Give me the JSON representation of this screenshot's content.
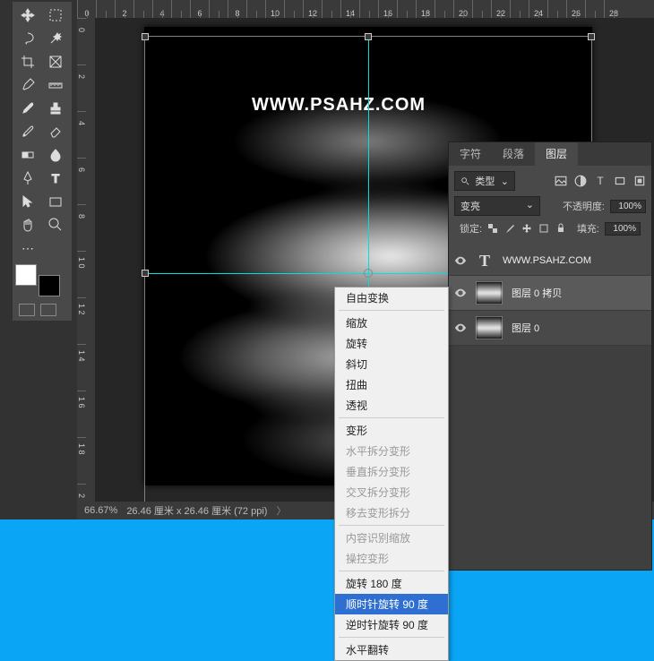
{
  "ruler_top": [
    "0",
    "",
    "2",
    "",
    "4",
    "",
    "6",
    "",
    "8",
    "",
    "10",
    "",
    "12",
    "",
    "14",
    "",
    "16",
    "",
    "18",
    "",
    "20",
    "",
    "22",
    "",
    "24",
    "",
    "26",
    "",
    "28"
  ],
  "ruler_left": [
    "0",
    "",
    "2",
    "",
    "4",
    "",
    "6",
    "",
    "8",
    "",
    "1\n0",
    "",
    "1\n2",
    "",
    "1\n4",
    "",
    "1\n6",
    "",
    "1\n8",
    "",
    "2"
  ],
  "watermark": "WWW.PSAHZ.COM",
  "status": {
    "zoom": "66.67%",
    "doc_info": "26.46 厘米 x 26.46 厘米 (72 ppi)"
  },
  "context_menu": {
    "free_transform": "自由变换",
    "scale": "缩放",
    "rotate": "旋转",
    "skew": "斜切",
    "distort": "扭曲",
    "perspective": "透视",
    "warp": "变形",
    "split_h": "水平拆分变形",
    "split_v": "垂直拆分变形",
    "split_x": "交叉拆分变形",
    "remove_split": "移去变形拆分",
    "content_aware": "内容识别缩放",
    "puppet": "操控变形",
    "rotate_180": "旋转 180 度",
    "rotate_cw": "顺时针旋转 90 度",
    "rotate_ccw": "逆时针旋转 90 度",
    "flip_h": "水平翻转"
  },
  "panel": {
    "tab_char": "字符",
    "tab_para": "段落",
    "tab_layer": "图层",
    "kind_label": "类型",
    "blend_mode": "变亮",
    "opacity_label": "不透明度:",
    "opacity_val": "100%",
    "lock_label": "锁定:",
    "fill_label": "填充:",
    "fill_val": "100%",
    "layers": [
      {
        "name": "WWW.PSAHZ.COM"
      },
      {
        "name": "图层 0 拷贝"
      },
      {
        "name": "图层 0"
      }
    ]
  }
}
